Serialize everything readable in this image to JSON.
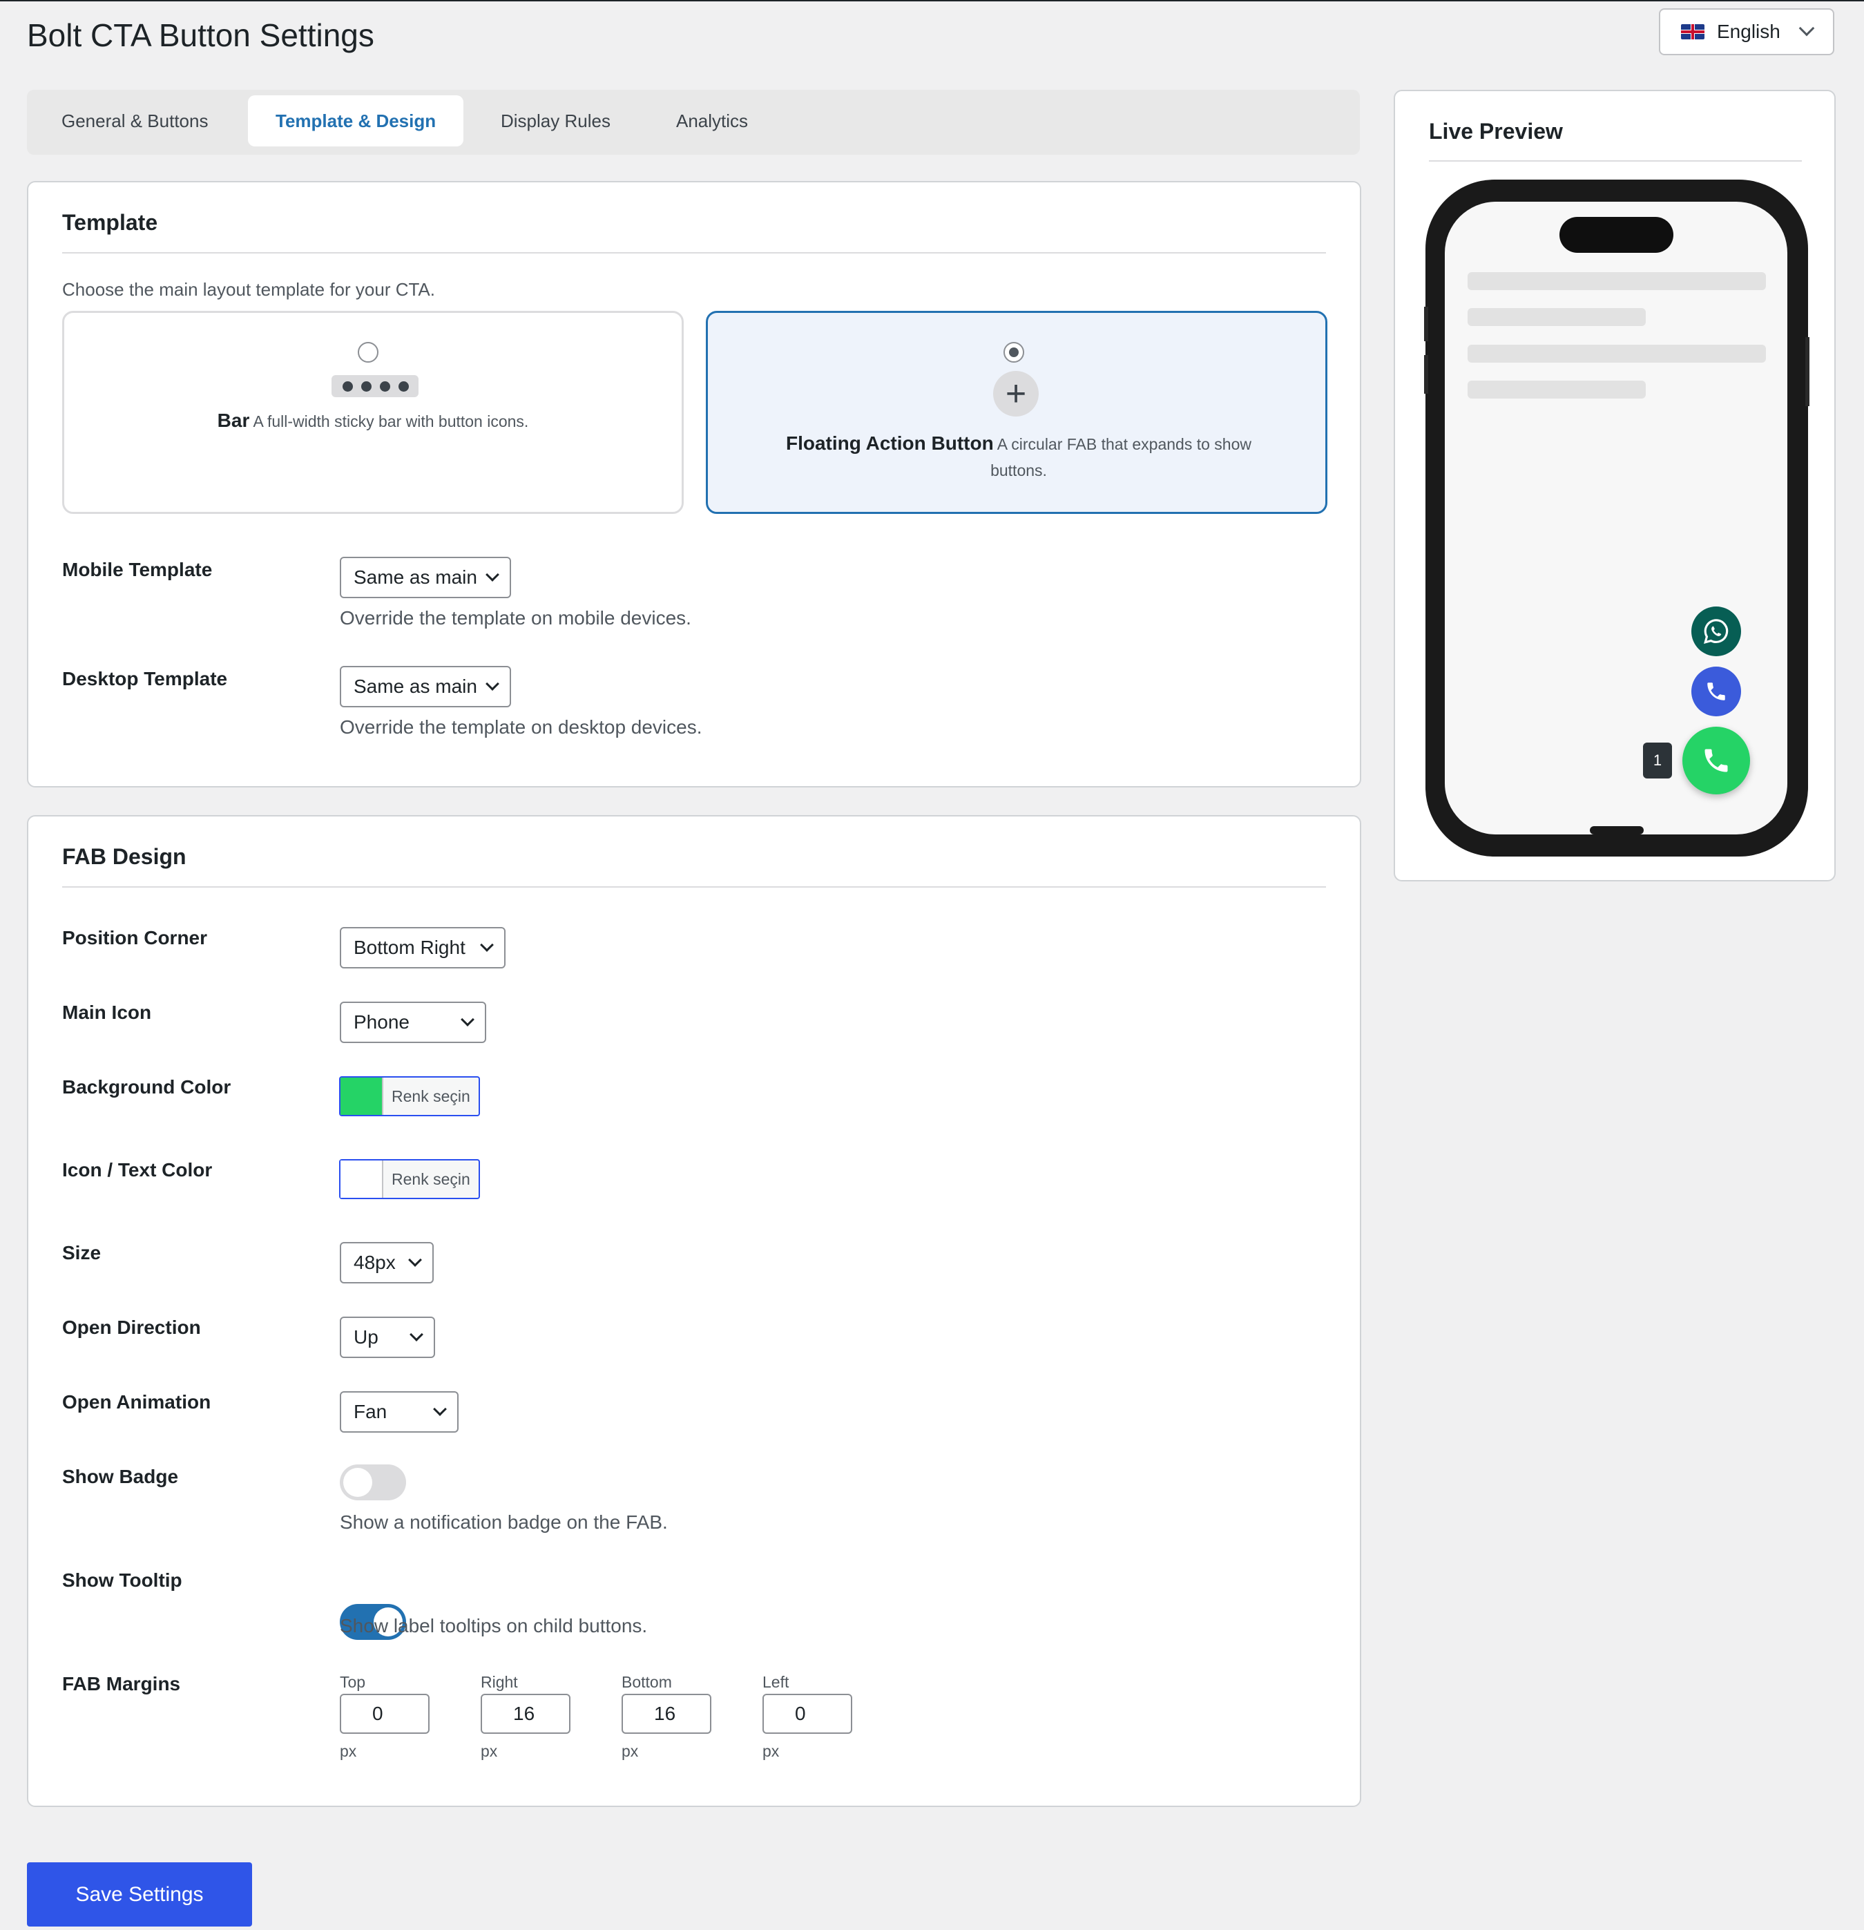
{
  "page": {
    "title": "Bolt CTA Button Settings"
  },
  "language": {
    "label": "English",
    "flag": "uk-flag"
  },
  "tabs": [
    {
      "label": "General & Buttons",
      "active": false
    },
    {
      "label": "Template & Design",
      "active": true
    },
    {
      "label": "Display Rules",
      "active": false
    },
    {
      "label": "Analytics",
      "active": false
    }
  ],
  "template_section": {
    "title": "Template",
    "description": "Choose the main layout template for your CTA.",
    "options": [
      {
        "name": "Bar",
        "description": "A full-width sticky bar with button icons.",
        "selected": false
      },
      {
        "name": "Floating Action Button",
        "description": "A circular FAB that expands to show buttons.",
        "selected": true
      }
    ],
    "mobile": {
      "label": "Mobile Template",
      "value": "Same as main",
      "help": "Override the template on mobile devices."
    },
    "desktop": {
      "label": "Desktop Template",
      "value": "Same as main",
      "help": "Override the template on desktop devices."
    }
  },
  "fab_design": {
    "title": "FAB Design",
    "position": {
      "label": "Position Corner",
      "value": "Bottom Right"
    },
    "main_icon": {
      "label": "Main Icon",
      "value": "Phone"
    },
    "bg_color": {
      "label": "Background Color",
      "button": "Renk seçin",
      "color": "#25d366"
    },
    "icon_color": {
      "label": "Icon / Text Color",
      "button": "Renk seçin",
      "color": "#ffffff"
    },
    "size": {
      "label": "Size",
      "value": "48px"
    },
    "direction": {
      "label": "Open Direction",
      "value": "Up"
    },
    "animation": {
      "label": "Open Animation",
      "value": "Fan"
    },
    "badge": {
      "label": "Show Badge",
      "on": false,
      "help": "Show a notification badge on the FAB."
    },
    "tooltip": {
      "label": "Show Tooltip",
      "on": true,
      "help": "Show label tooltips on child buttons."
    },
    "margins": {
      "label": "FAB Margins",
      "unit": "px",
      "fields": [
        {
          "label": "Top",
          "value": "0"
        },
        {
          "label": "Right",
          "value": "16"
        },
        {
          "label": "Bottom",
          "value": "16"
        },
        {
          "label": "Left",
          "value": "0"
        }
      ]
    }
  },
  "save_button": "Save Settings",
  "preview": {
    "title": "Live Preview",
    "badge": "1",
    "colors": {
      "whatsapp": "#075e54",
      "call": "#3b5bdb",
      "fab": "#25d366"
    }
  }
}
